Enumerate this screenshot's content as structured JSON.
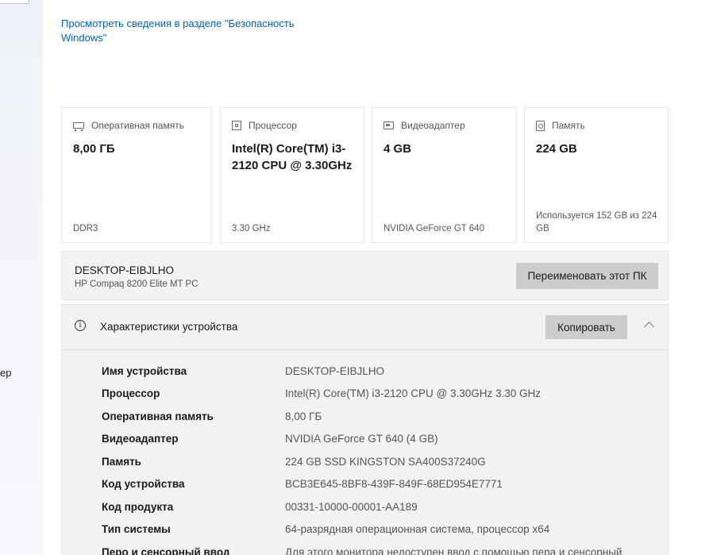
{
  "security_link": "Просмотреть сведения в разделе \"Безопасность Windows\"",
  "sidebar_fragment": "ер",
  "cards": [
    {
      "icon": "ram-icon",
      "label": "Оперативная память",
      "value": "8,00 ГБ",
      "sub": "DDR3"
    },
    {
      "icon": "processor-icon",
      "label": "Процессор",
      "value": "Intel(R) Core(TM) i3-2120 CPU @ 3.30GHz",
      "sub": "3.30 GHz"
    },
    {
      "icon": "graphics-card-icon",
      "label": "Видеоадаптер",
      "value": "4 GB",
      "sub": "NVIDIA GeForce GT 640"
    },
    {
      "icon": "storage-icon",
      "label": "Память",
      "value": "224 GB",
      "sub": "Используется 152 GB из 224 GB"
    }
  ],
  "pc": {
    "name": "DESKTOP-EIBJLHO",
    "model": "HP Compaq 8200 Elite MT PC",
    "rename_label": "Переименовать этот ПК"
  },
  "specs": {
    "title": "Характеристики устройства",
    "copy_label": "Копировать",
    "rows": [
      {
        "key": "Имя устройства",
        "value": "DESKTOP-EIBJLHO"
      },
      {
        "key": "Процессор",
        "value": "Intel(R) Core(TM) i3-2120 CPU @ 3.30GHz   3.30 GHz"
      },
      {
        "key": "Оперативная память",
        "value": "8,00 ГБ"
      },
      {
        "key": "Видеоадаптер",
        "value": "NVIDIA GeForce GT 640 (4 GB)"
      },
      {
        "key": "Память",
        "value": "224 GB SSD KINGSTON SA400S37240G"
      },
      {
        "key": "Код устройства",
        "value": "BCB3E645-8BF8-439F-849F-68ED954E7771"
      },
      {
        "key": "Код продукта",
        "value": "00331-10000-00001-AA189"
      },
      {
        "key": "Тип системы",
        "value": "64-разрядная операционная система, процессор x64"
      },
      {
        "key": "Перо и сенсорный ввод",
        "value": "Для этого монитора недоступен ввод с помощью пера и сенсорный"
      }
    ]
  }
}
